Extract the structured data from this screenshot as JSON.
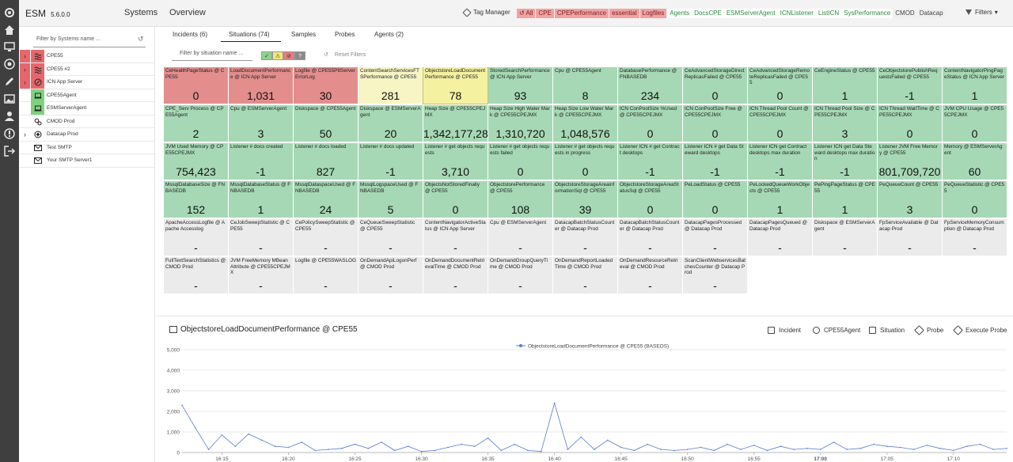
{
  "app": {
    "name": "ESM",
    "version": "5.6.0.0",
    "nav": [
      "Systems",
      "Overview"
    ],
    "tag_manager_label": "Tag Manager",
    "filters_label": "Filters"
  },
  "tags": [
    {
      "label": "All",
      "state": "red",
      "icon": "undo-icon"
    },
    {
      "label": "CPE",
      "state": "red"
    },
    {
      "label": "CPEPerformance",
      "state": "red"
    },
    {
      "label": "essential",
      "state": "red"
    },
    {
      "label": "Logfiles",
      "state": "red"
    },
    {
      "label": "Agents",
      "state": "green"
    },
    {
      "label": "DocsCPE",
      "state": "green"
    },
    {
      "label": "ESMServerAgent",
      "state": "green"
    },
    {
      "label": "ICNListener",
      "state": "green"
    },
    {
      "label": "ListICN",
      "state": "green"
    },
    {
      "label": "SysPerformance",
      "state": "green"
    },
    {
      "label": "CMOD",
      "state": "grey"
    },
    {
      "label": "Datacap",
      "state": "grey"
    }
  ],
  "systems": {
    "filter_placeholder": "Filter by Systems name ...",
    "items": [
      {
        "label": "CPE55",
        "status": "red",
        "icon": "waves-icon",
        "expandable": true
      },
      {
        "label": "CPE55 #2",
        "status": "red",
        "icon": "waves-icon",
        "expandable": true
      },
      {
        "label": "ICN App Server",
        "status": "red",
        "icon": "compass-icon",
        "expandable": true
      },
      {
        "label": "CPE55Agent",
        "status": "green",
        "icon": "laptop-icon",
        "expandable": false
      },
      {
        "label": "ESMServerAgent",
        "status": "green",
        "icon": "laptop-icon",
        "expandable": false
      },
      {
        "label": "CMOD Prod",
        "status": "none",
        "icon": "gears-icon",
        "expandable": false
      },
      {
        "label": "Datacap Prod",
        "status": "none",
        "icon": "datacap-icon",
        "expandable": true
      },
      {
        "label": "Test SMTP",
        "status": "none",
        "icon": "mail-icon",
        "expandable": false
      },
      {
        "label": "Your SMTP Server1",
        "status": "none",
        "icon": "mail-icon",
        "expandable": false
      }
    ]
  },
  "main": {
    "tabs": [
      "Incidents (6)",
      "Situations (74)",
      "Samples",
      "Probes",
      "Agents (2)"
    ],
    "active_tab": 1,
    "situation_filter_placeholder": "Filter by situation name ...",
    "severity_buttons": [
      {
        "glyph": "✓",
        "color": "#8fd18f",
        "icon": "check-icon"
      },
      {
        "glyph": "⚠",
        "color": "#f1e97a",
        "icon": "warning-icon"
      },
      {
        "glyph": "⊘",
        "color": "#e57e7e",
        "icon": "error-icon"
      },
      {
        "glyph": "?",
        "color": "#8a8a8a",
        "icon": "unknown-icon"
      }
    ],
    "reset_filters_label": "Reset Filters"
  },
  "situations": [
    {
      "name": "CeHealthPageStatus @ CPE55",
      "value": "0",
      "sev": "red"
    },
    {
      "name": "LoadDocumentPerformance @ ICN App Server",
      "value": "1,031",
      "sev": "red"
    },
    {
      "name": "Logfile @ CPE55P8ServerErrorLog",
      "value": "30",
      "sev": "red"
    },
    {
      "name": "ContentSearchServicesFTSPerformance @ CPE55",
      "value": "281",
      "sev": "paleyellow"
    },
    {
      "name": "ObjectstoreLoadDocumentPerformance @ CPE55",
      "value": "78",
      "sev": "yellow"
    },
    {
      "name": "StoredSearchPerformance @ ICN App Server",
      "value": "93",
      "sev": "green"
    },
    {
      "name": "Cpu @ CPE55Agent",
      "value": "8",
      "sev": "green"
    },
    {
      "name": "DatabasePerformance @ FNBASEDB",
      "value": "234",
      "sev": "green"
    },
    {
      "name": "CeAdvancedStorageDirectReplicasFailed @ CPE55",
      "value": "0",
      "sev": "green"
    },
    {
      "name": "CeAdvancedStorageRemoteReplicasFailed @ CPE55",
      "value": "0",
      "sev": "green"
    },
    {
      "name": "CeEngineStatus @ CPE55",
      "value": "1",
      "sev": "green"
    },
    {
      "name": "CeObjectstorePublishRequestsFailed @ CPE55",
      "value": "-1",
      "sev": "green"
    },
    {
      "name": "ContentNavigatorPingPageStatus @ ICN App Server",
      "value": "1",
      "sev": "green"
    },
    {
      "name": "CPE_Serv Process @ CPE55Agent",
      "value": "2",
      "sev": "green"
    },
    {
      "name": "Cpu @ ESMServerAgent",
      "value": "3",
      "sev": "green"
    },
    {
      "name": "Diskspace @ CPE55Agent",
      "value": "50",
      "sev": "green"
    },
    {
      "name": "Diskspace @ ESMServerAgent",
      "value": "20",
      "sev": "green"
    },
    {
      "name": "Heap Size @ CPE55CPEJMX",
      "value": "1,342,177,280",
      "sev": "green"
    },
    {
      "name": "Heap Size High Water Mark @ CPE55CPEJMX",
      "value": "1,310,720",
      "sev": "green"
    },
    {
      "name": "Heap Size Low Water Mark @ CPE55CPEJMX",
      "value": "1,048,576",
      "sev": "green"
    },
    {
      "name": "ICN ConPoolSize %Used @ CPE55CPEJMX",
      "value": "0",
      "sev": "green"
    },
    {
      "name": "ICN ConPoolSize Free @ CPE55CPEJMX",
      "value": "0",
      "sev": "green"
    },
    {
      "name": "ICN Thread Pool Count @ CPE55CPEJMX",
      "value": "0",
      "sev": "green"
    },
    {
      "name": "ICN Thread Pool Size @ CPE55CPEJMX",
      "value": "3",
      "sev": "green"
    },
    {
      "name": "ICN Thread WaitTime @ CPE55CPEJMX",
      "value": "0",
      "sev": "green"
    },
    {
      "name": "JVM CPU Usage @ CPE55CPEJMX",
      "value": "0",
      "sev": "green"
    },
    {
      "name": "JVM Used Memory @ CPE55CPEJMX",
      "value": "754,423",
      "sev": "green"
    },
    {
      "name": "Listener # docs created",
      "value": "-1",
      "sev": "green"
    },
    {
      "name": "Listener # docs loaded",
      "value": "827",
      "sev": "green"
    },
    {
      "name": "Listener # docs updated",
      "value": "-1",
      "sev": "green"
    },
    {
      "name": "Listener # get objects requests",
      "value": "3,710",
      "sev": "green"
    },
    {
      "name": "Listener # get objects requests failed",
      "value": "0",
      "sev": "green"
    },
    {
      "name": "Listener # get objects requests in progress",
      "value": "0",
      "sev": "green"
    },
    {
      "name": "Listener ICN # get Contract desktops",
      "value": "-1",
      "sev": "green"
    },
    {
      "name": "Listener ICN # get Data Steward desktops",
      "value": "-1",
      "sev": "green"
    },
    {
      "name": "Listener ICN get Contract desktops max duration",
      "value": "-1",
      "sev": "green"
    },
    {
      "name": "Listener ICN get Data Steward desktops max duration",
      "value": "-1",
      "sev": "green"
    },
    {
      "name": "Listener JVM Free Memory @ CPE55",
      "value": "801,709,720",
      "sev": "green"
    },
    {
      "name": "Memory @ ESMServerAgent",
      "value": "60",
      "sev": "green"
    },
    {
      "name": "MssqlDatabaseSize @ FNBASEDB",
      "value": "152",
      "sev": "green"
    },
    {
      "name": "MssqlDatabaseStatus @ FNBASEDB",
      "value": "1",
      "sev": "green"
    },
    {
      "name": "MssqlDataspaceUsed @ FNBASEDB",
      "value": "24",
      "sev": "green"
    },
    {
      "name": "MssqlLogspaceUsed @ FNBASEDB",
      "value": "5",
      "sev": "green"
    },
    {
      "name": "ObjectsNotStoredFinally @ CPE55",
      "value": "0",
      "sev": "green"
    },
    {
      "name": "ObjectstorePerformance @ CPE55",
      "value": "108",
      "sev": "green"
    },
    {
      "name": "ObjectstoreStorageAreainformationSql @ CPE55",
      "value": "39",
      "sev": "green"
    },
    {
      "name": "ObjectstoreStorageAreaStatusSql @ CPE55",
      "value": "0",
      "sev": "green"
    },
    {
      "name": "PeLoadStatus @ CPE55",
      "value": "0",
      "sev": "green"
    },
    {
      "name": "PeLockedQueueWorkObjects @ CPE55",
      "value": "1",
      "sev": "green"
    },
    {
      "name": "PePingPageStatus @ CPE55",
      "value": "1",
      "sev": "green"
    },
    {
      "name": "PeQueueCount @ CPE55",
      "value": "3",
      "sev": "green"
    },
    {
      "name": "PeQueueStatistic @ CPE55",
      "value": "0",
      "sev": "green"
    },
    {
      "name": "ApacheAccessLogfile @ Apache Accesslog",
      "value": "-",
      "sev": "grey"
    },
    {
      "name": "CeJobSweepStatistic @ CPE55",
      "value": "-",
      "sev": "grey"
    },
    {
      "name": "CePolicySweepStatistic @ CPE55",
      "value": "-",
      "sev": "grey"
    },
    {
      "name": "CeQueueSweepStatistic @ CPE55",
      "value": "-",
      "sev": "grey"
    },
    {
      "name": "ContentNavigatorActiveStatus @ ICN App Server",
      "value": "-",
      "sev": "grey"
    },
    {
      "name": "Cpu @ ESMServerAgent",
      "value": "-",
      "sev": "grey"
    },
    {
      "name": "DatacapBatchStatusCounter @ Datacap Prod",
      "value": "-",
      "sev": "grey"
    },
    {
      "name": "DatacapBatchStatusCounter @ Datacap Prod",
      "value": "-",
      "sev": "grey"
    },
    {
      "name": "DatacapPagesProcessed @ Datacap Prod",
      "value": "-",
      "sev": "grey"
    },
    {
      "name": "DatacapPagesQueued @ Datacap Prod",
      "value": "-",
      "sev": "grey"
    },
    {
      "name": "Diskspace @ ESMServerAgent",
      "value": "-",
      "sev": "grey"
    },
    {
      "name": "FpServiceAvailable @ Datacap Prod",
      "value": "-",
      "sev": "grey"
    },
    {
      "name": "FpServiceMemoryConsumption @ Datacap Prod",
      "value": "-",
      "sev": "grey"
    },
    {
      "name": "FullTextSearchStatistics @ CMOD Prod",
      "value": "-",
      "sev": "grey"
    },
    {
      "name": "JVM FreeMemory MBeanAttribute @ CPE55CPEJMX",
      "value": "-",
      "sev": "grey"
    },
    {
      "name": "Logfile @ CPE55WASLOG",
      "value": "-",
      "sev": "grey"
    },
    {
      "name": "OnDemandApiLogonPerf @ CMOD Prod",
      "value": "-",
      "sev": "grey"
    },
    {
      "name": "OnDemandDocumentRetrievalTime @ CMOD Prod",
      "value": "-",
      "sev": "grey"
    },
    {
      "name": "OnDemandGroupQueryTime @ CMOD Prod",
      "value": "-",
      "sev": "grey"
    },
    {
      "name": "OnDemandReportLoadedTime @ CMOD Prod",
      "value": "-",
      "sev": "grey"
    },
    {
      "name": "OnDemandResourceRetrieval @ CMOD Prod",
      "value": "-",
      "sev": "grey"
    },
    {
      "name": "ScanClientWebservicesBatchesCounter @ Datacap Prod",
      "value": "-",
      "sev": "grey"
    }
  ],
  "details": {
    "title": "ObjectstoreLoadDocumentPerformance @ CPE55",
    "actions": [
      {
        "label": "Incident",
        "icon": "incident-icon"
      },
      {
        "label": "CPE55Agent",
        "icon": "agent-icon"
      },
      {
        "label": "Situation",
        "icon": "situation-icon"
      },
      {
        "label": "Probe",
        "icon": "probe-icon"
      },
      {
        "label": "Execute Probe",
        "icon": "execute-probe-icon"
      }
    ]
  },
  "chart_data": {
    "type": "line",
    "title": "",
    "xlabel": "",
    "ylabel": "",
    "series": [
      {
        "name": "ObjectstoreLoadDocumentPerformance @ CPE55 (BASEOS)",
        "color": "#5b7bd5",
        "points": [
          [
            "16:12",
            2300
          ],
          [
            "16:13",
            1200
          ],
          [
            "16:14",
            150
          ],
          [
            "16:15",
            850
          ],
          [
            "16:16",
            300
          ],
          [
            "16:17",
            900
          ],
          [
            "16:18",
            600
          ],
          [
            "16:19",
            300
          ],
          [
            "16:20",
            250
          ],
          [
            "16:21",
            500
          ],
          [
            "16:22",
            100
          ],
          [
            "16:23",
            150
          ],
          [
            "16:24",
            200
          ],
          [
            "16:25",
            400
          ],
          [
            "16:26",
            200
          ],
          [
            "16:27",
            500
          ],
          [
            "16:28",
            100
          ],
          [
            "16:29",
            300
          ],
          [
            "16:30",
            50
          ],
          [
            "16:31",
            100
          ],
          [
            "16:32",
            250
          ],
          [
            "16:33",
            400
          ],
          [
            "16:34",
            300
          ],
          [
            "16:35",
            700
          ],
          [
            "16:36",
            100
          ],
          [
            "16:37",
            400
          ],
          [
            "16:38",
            100
          ],
          [
            "16:39",
            50
          ],
          [
            "16:40",
            2400
          ],
          [
            "16:41",
            150
          ],
          [
            "16:42",
            750
          ],
          [
            "16:43",
            150
          ],
          [
            "16:44",
            600
          ],
          [
            "16:45",
            250
          ],
          [
            "16:46",
            100
          ],
          [
            "16:47",
            400
          ],
          [
            "16:48",
            150
          ],
          [
            "16:49",
            100
          ],
          [
            "16:50",
            150
          ],
          [
            "16:51",
            250
          ],
          [
            "16:52",
            100
          ],
          [
            "16:53",
            400
          ],
          [
            "16:54",
            150
          ],
          [
            "16:55",
            350
          ],
          [
            "16:56",
            100
          ],
          [
            "16:57",
            300
          ],
          [
            "16:58",
            150
          ],
          [
            "16:59",
            200
          ],
          [
            "17:00",
            150
          ],
          [
            "17:01",
            500
          ],
          [
            "17:02",
            150
          ],
          [
            "17:03",
            200
          ],
          [
            "17:04",
            400
          ],
          [
            "17:05",
            300
          ],
          [
            "17:06",
            250
          ],
          [
            "17:07",
            150
          ],
          [
            "17:08",
            350
          ],
          [
            "17:09",
            200
          ],
          [
            "17:10",
            100
          ],
          [
            "17:11",
            300
          ],
          [
            "17:12",
            400
          ],
          [
            "17:13",
            150
          ],
          [
            "17:14",
            200
          ]
        ]
      }
    ],
    "ylim": [
      0,
      5000
    ],
    "yticks": [
      "0",
      "1,000",
      "2,000",
      "3,000",
      "4,000",
      "5,000"
    ],
    "xticks": [
      "16:15",
      "16:20",
      "16:25",
      "16:30",
      "16:35",
      "16:40",
      "16:45",
      "16:50",
      "16:55",
      "17:00",
      "17:05",
      "17:10"
    ],
    "bold_tick": "17:00",
    "grid": "horizontal",
    "legend_position": "top-center"
  }
}
